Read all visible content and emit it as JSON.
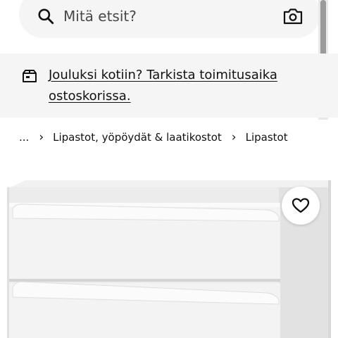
{
  "search": {
    "placeholder": "Mitä etsit?",
    "search_icon": "search-icon",
    "camera_icon": "camera-icon"
  },
  "banner": {
    "icon": "delivery-box-icon",
    "text": "Jouluksi kotiin? Tarkista toimitusaika ostoskorissa."
  },
  "breadcrumb": {
    "items": [
      {
        "label": "..."
      },
      {
        "label": "Lipastot, yöpöydät & laatikostot"
      },
      {
        "label": "Lipastot"
      }
    ],
    "separator": "›"
  },
  "product": {
    "image": "white-chest-of-drawers",
    "favorite_icon": "heart-icon"
  },
  "colors": {
    "search_bg": "#f5f5f5",
    "banner_bg": "#f5f5f5",
    "text": "#111111",
    "placeholder": "#484848"
  }
}
